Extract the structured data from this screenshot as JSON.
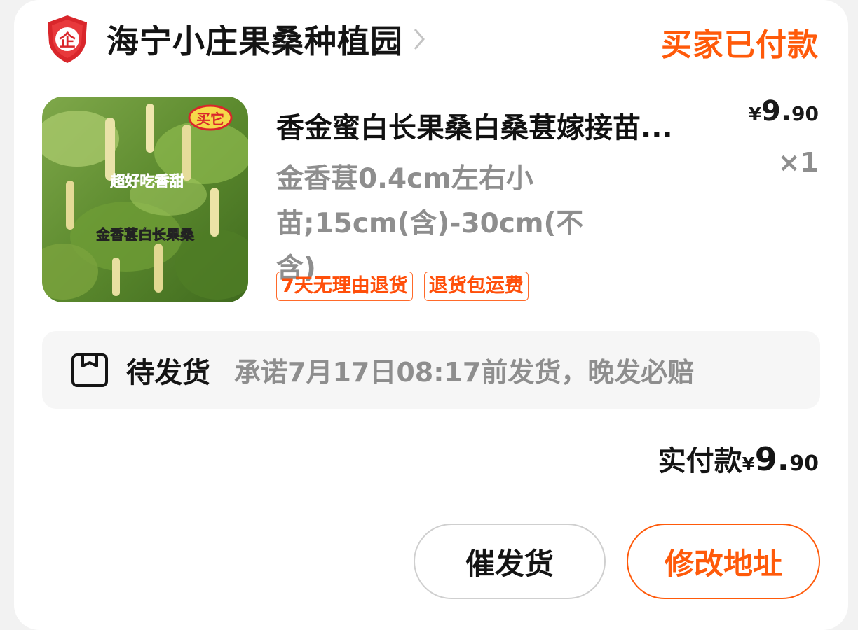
{
  "shop": {
    "badge_char": "企",
    "name": "海宁小庄果桑种植园"
  },
  "order": {
    "status": "买家已付款"
  },
  "product": {
    "title": "香金蜜白长果桑白桑葚嫁接苗...",
    "sku": "金香葚0.4cm左右小苗;15cm(含)-30cm(不含)",
    "price": {
      "currency": "¥",
      "integer": "9.",
      "decimal": "90"
    },
    "quantity": "×1",
    "tags": [
      "7天无理由退货",
      "退货包运费"
    ],
    "thumbnail_text": {
      "stamp": "买它",
      "slogan": "超好吃香甜",
      "caption": "金香葚白长果桑"
    }
  },
  "shipping": {
    "state": "待发货",
    "promise": "承诺7月17日08:17前发货，晚发必赔"
  },
  "payment": {
    "label": "实付款",
    "currency": "¥",
    "integer": "9.",
    "decimal": "90"
  },
  "actions": {
    "urge_label": "催发货",
    "change_address_label": "修改地址"
  },
  "colors": {
    "accent": "#ff5a0a",
    "badge_red": "#d9262b",
    "muted_text": "#8e8e8e"
  }
}
